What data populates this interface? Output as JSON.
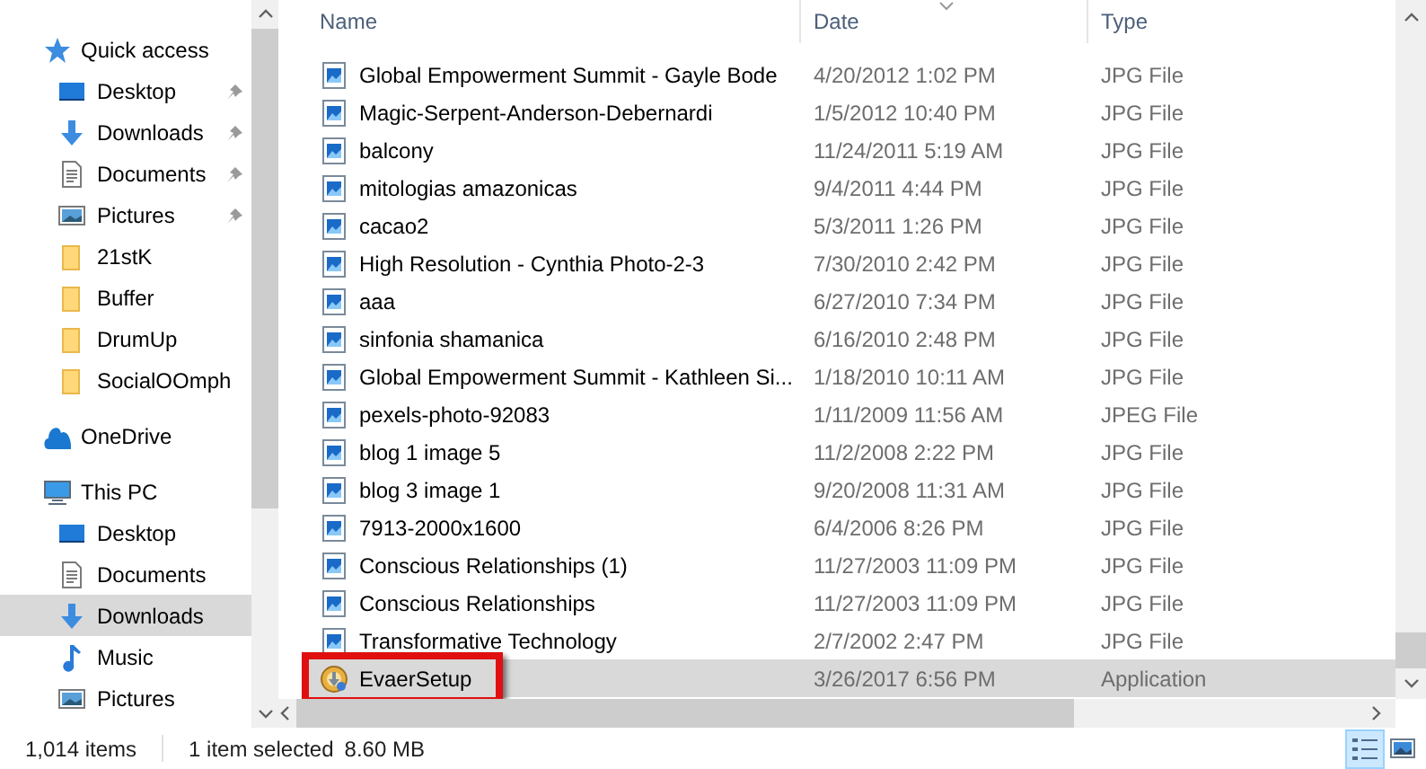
{
  "sidebar": {
    "items": [
      {
        "label": "Quick access",
        "kind": "star",
        "selected": false,
        "children": [
          {
            "label": "Desktop",
            "kind": "desktop",
            "pinned": true,
            "selected": false
          },
          {
            "label": "Downloads",
            "kind": "download",
            "pinned": true,
            "selected": false
          },
          {
            "label": "Documents",
            "kind": "document",
            "pinned": true,
            "selected": false
          },
          {
            "label": "Pictures",
            "kind": "pictures",
            "pinned": true,
            "selected": false
          },
          {
            "label": "21stK",
            "kind": "folder",
            "pinned": false,
            "selected": false
          },
          {
            "label": "Buffer",
            "kind": "folder",
            "pinned": false,
            "selected": false
          },
          {
            "label": "DrumUp",
            "kind": "folder",
            "pinned": false,
            "selected": false
          },
          {
            "label": "SocialOOmph",
            "kind": "folder",
            "pinned": false,
            "selected": false
          }
        ]
      },
      {
        "label": "OneDrive",
        "kind": "cloud",
        "selected": false
      },
      {
        "label": "This PC",
        "kind": "pc",
        "selected": false,
        "children": [
          {
            "label": "Desktop",
            "kind": "desktop",
            "pinned": false,
            "selected": false
          },
          {
            "label": "Documents",
            "kind": "document",
            "pinned": false,
            "selected": false
          },
          {
            "label": "Downloads",
            "kind": "download",
            "pinned": false,
            "selected": true
          },
          {
            "label": "Music",
            "kind": "music",
            "pinned": false,
            "selected": false
          },
          {
            "label": "Pictures",
            "kind": "pictures",
            "pinned": false,
            "selected": false
          }
        ]
      }
    ]
  },
  "table": {
    "columns": [
      "Name",
      "Date",
      "Type"
    ],
    "rows": [
      {
        "name": "Global Empowerment Summit - Gayle Bode",
        "date": "4/20/2012 1:02 PM",
        "type": "JPG File",
        "kind": "image",
        "selected": false,
        "highlighted": false
      },
      {
        "name": "Magic-Serpent-Anderson-Debernardi",
        "date": "1/5/2012 10:40 PM",
        "type": "JPG File",
        "kind": "image",
        "selected": false,
        "highlighted": false
      },
      {
        "name": "balcony",
        "date": "11/24/2011 5:19 AM",
        "type": "JPG File",
        "kind": "image",
        "selected": false,
        "highlighted": false
      },
      {
        "name": "mitologias amazonicas",
        "date": "9/4/2011 4:44 PM",
        "type": "JPG File",
        "kind": "image",
        "selected": false,
        "highlighted": false
      },
      {
        "name": "cacao2",
        "date": "5/3/2011 1:26 PM",
        "type": "JPG File",
        "kind": "image",
        "selected": false,
        "highlighted": false
      },
      {
        "name": "High Resolution - Cynthia Photo-2-3",
        "date": "7/30/2010 2:42 PM",
        "type": "JPG File",
        "kind": "image",
        "selected": false,
        "highlighted": false
      },
      {
        "name": "aaa",
        "date": "6/27/2010 7:34 PM",
        "type": "JPG File",
        "kind": "image",
        "selected": false,
        "highlighted": false
      },
      {
        "name": "sinfonia shamanica",
        "date": "6/16/2010 2:48 PM",
        "type": "JPG File",
        "kind": "image",
        "selected": false,
        "highlighted": false
      },
      {
        "name": "Global Empowerment Summit - Kathleen Si...",
        "date": "1/18/2010 10:11 AM",
        "type": "JPG File",
        "kind": "image",
        "selected": false,
        "highlighted": false
      },
      {
        "name": "pexels-photo-92083",
        "date": "1/11/2009 11:56 AM",
        "type": "JPEG File",
        "kind": "image",
        "selected": false,
        "highlighted": false
      },
      {
        "name": "blog 1 image 5",
        "date": "11/2/2008 2:22 PM",
        "type": "JPG File",
        "kind": "image",
        "selected": false,
        "highlighted": false
      },
      {
        "name": "blog 3 image 1",
        "date": "9/20/2008 11:31 AM",
        "type": "JPG File",
        "kind": "image",
        "selected": false,
        "highlighted": false
      },
      {
        "name": "7913-2000x1600",
        "date": "6/4/2006 8:26 PM",
        "type": "JPG File",
        "kind": "image",
        "selected": false,
        "highlighted": false
      },
      {
        "name": "Conscious Relationships (1)",
        "date": "11/27/2003 11:09 PM",
        "type": "JPG File",
        "kind": "image",
        "selected": false,
        "highlighted": false
      },
      {
        "name": "Conscious Relationships",
        "date": "11/27/2003 11:09 PM",
        "type": "JPG File",
        "kind": "image",
        "selected": false,
        "highlighted": false
      },
      {
        "name": "Transformative Technology",
        "date": "2/7/2002 2:47 PM",
        "type": "JPG File",
        "kind": "image",
        "selected": false,
        "highlighted": false
      },
      {
        "name": "EvaerSetup",
        "date": "3/26/2017 6:56 PM",
        "type": "Application",
        "kind": "app",
        "selected": true,
        "highlighted": true
      }
    ]
  },
  "status_bar": {
    "item_count": "1,014 items",
    "selection": "1 item selected",
    "size": "8.60 MB"
  }
}
